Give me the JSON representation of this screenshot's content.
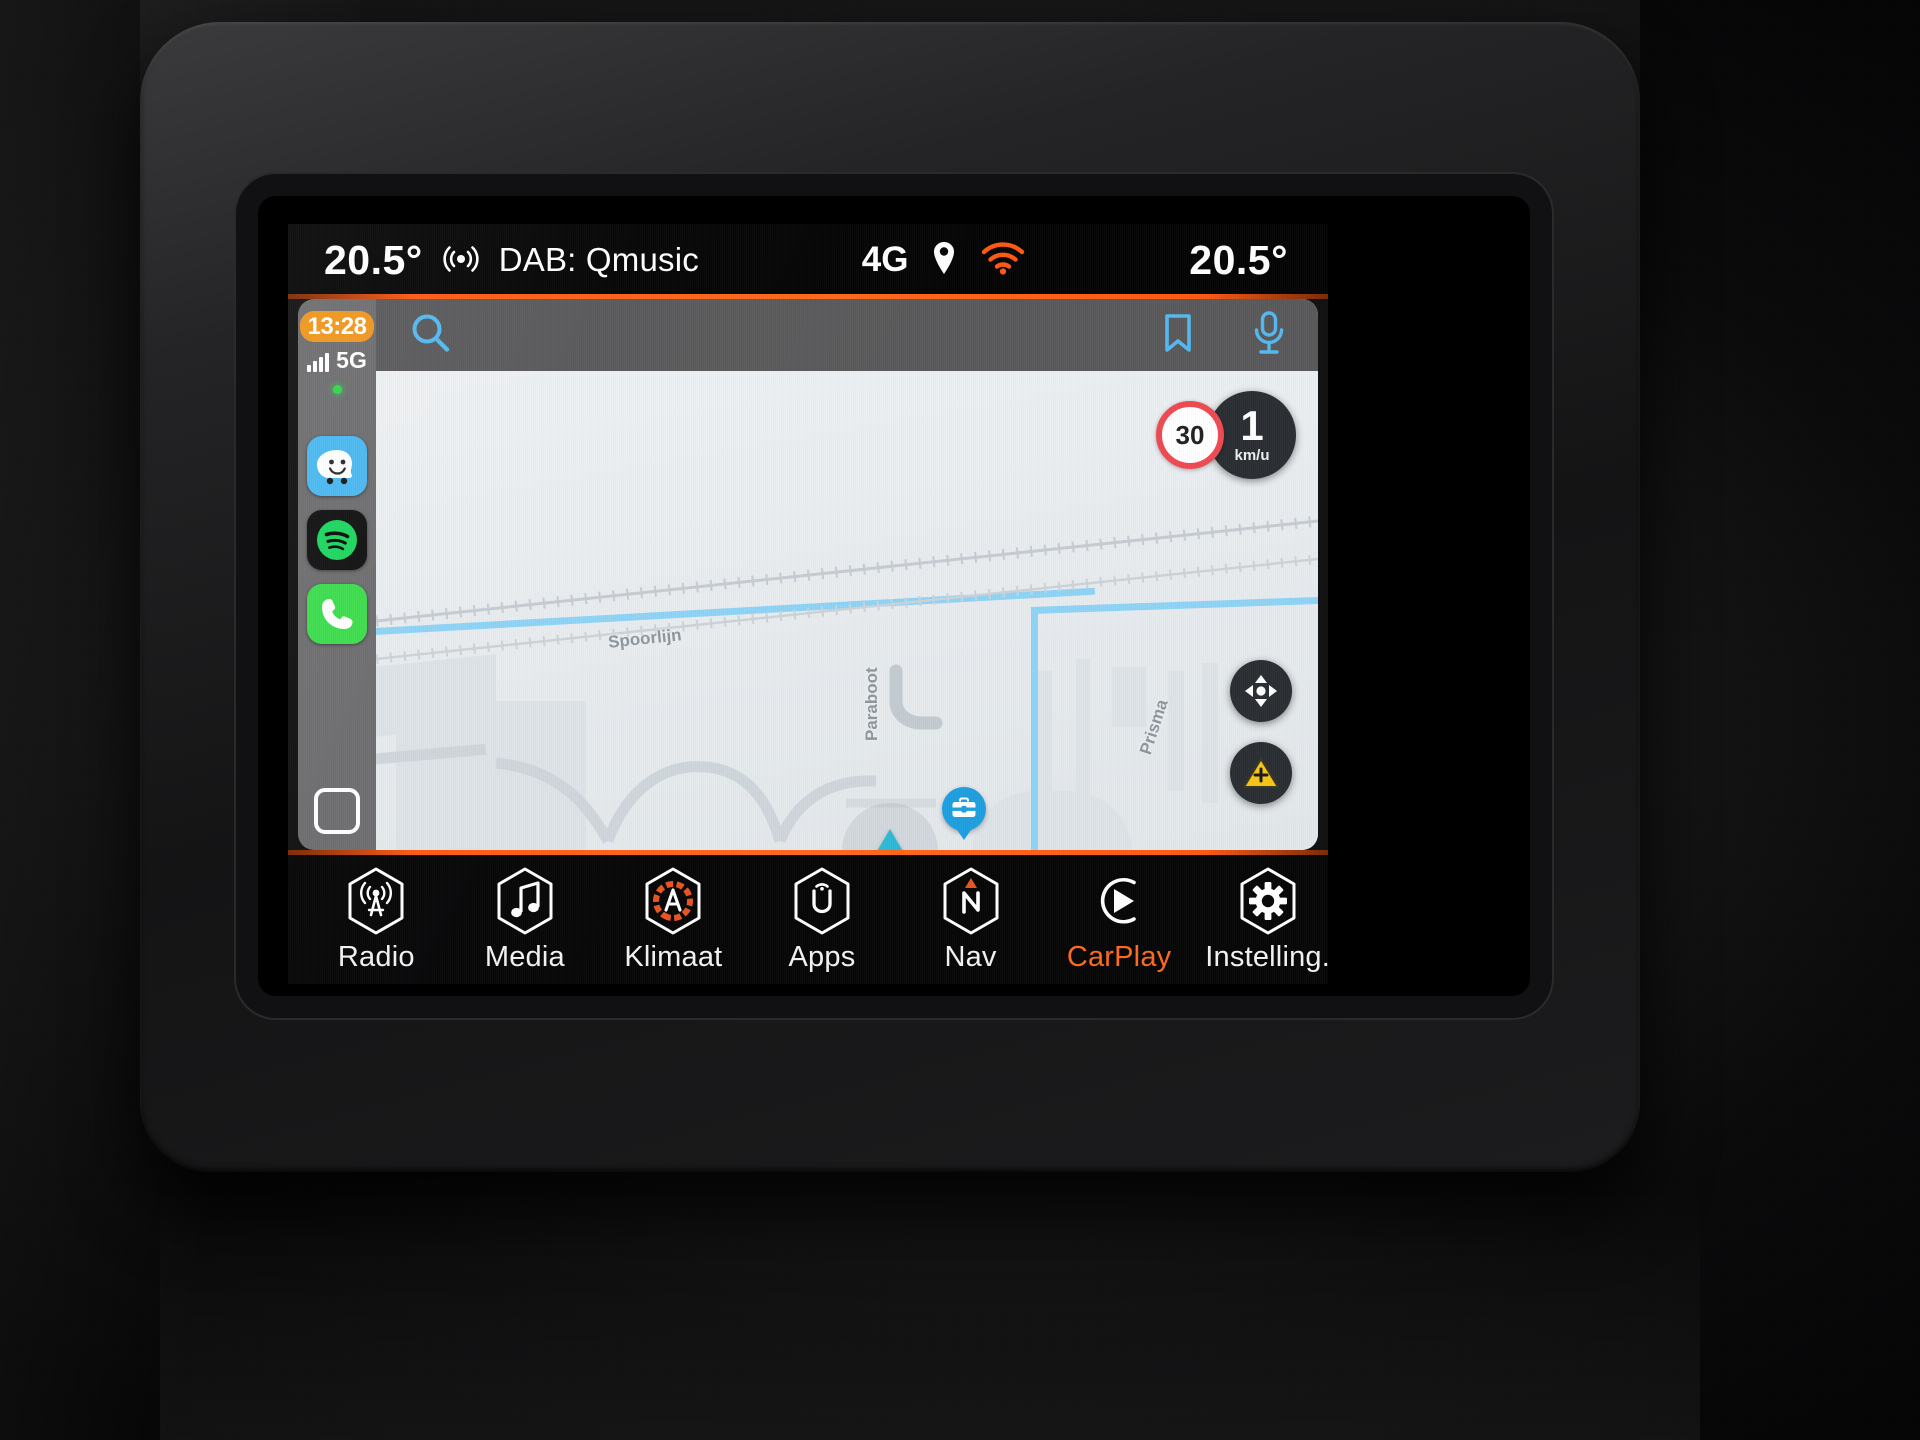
{
  "vehicle_ui": {
    "status_bar": {
      "left_temperature": "20.5°",
      "audio_source": "DAB: Qmusic",
      "network": "4G",
      "right_temperature": "20.5°",
      "icons": [
        "radio-broadcast-icon",
        "location-pin-icon",
        "wifi-icon"
      ],
      "wifi_color": "#ff5a12"
    },
    "bottom_bar": {
      "items": [
        {
          "label": "Radio",
          "icon": "radio-tower-icon",
          "active": false
        },
        {
          "label": "Media",
          "icon": "music-note-icon",
          "active": false
        },
        {
          "label": "Klimaat",
          "icon": "climate-auto-icon",
          "active": false
        },
        {
          "label": "Apps",
          "icon": "uconnect-u-icon",
          "active": false
        },
        {
          "label": "Nav",
          "icon": "compass-north-icon",
          "active": false
        },
        {
          "label": "CarPlay",
          "icon": "carplay-icon",
          "active": true
        },
        {
          "label": "Instelling.",
          "icon": "gear-icon",
          "active": false
        }
      ],
      "accent_color": "#ff6a1c"
    }
  },
  "carplay": {
    "sidebar": {
      "clock": "13:28",
      "network_label": "5G",
      "signal_bars": 4,
      "recording_indicator": true,
      "apps": [
        {
          "name": "Waze",
          "icon": "waze-icon",
          "color": "#4bb8f0"
        },
        {
          "name": "Spotify",
          "icon": "spotify-icon",
          "color": "#1db954"
        },
        {
          "name": "Phone",
          "icon": "phone-icon",
          "color": "#3ddc4e"
        }
      ],
      "home_button": "home-button"
    },
    "app": {
      "name": "Waze",
      "toolbar": {
        "search_icon": "search-icon",
        "bookmark_icon": "bookmark-icon",
        "microphone_icon": "microphone-icon",
        "icon_color": "#53b9f0"
      },
      "map": {
        "labels": [
          {
            "text": "Spoorlijn",
            "type": "railway"
          },
          {
            "text": "Paraboot",
            "type": "street"
          },
          {
            "text": "Prisma",
            "type": "street"
          }
        ],
        "speed_limit": "30",
        "current_speed": "1",
        "speed_unit": "km/u",
        "vehicle_marker": "navigation-arrow",
        "poi_marker": "toolbox-poi-icon",
        "controls": [
          {
            "name": "pan-control",
            "icon": "dpad-icon"
          },
          {
            "name": "report-control",
            "icon": "warning-triangle-icon",
            "color": "#f6c518"
          }
        ]
      }
    }
  }
}
